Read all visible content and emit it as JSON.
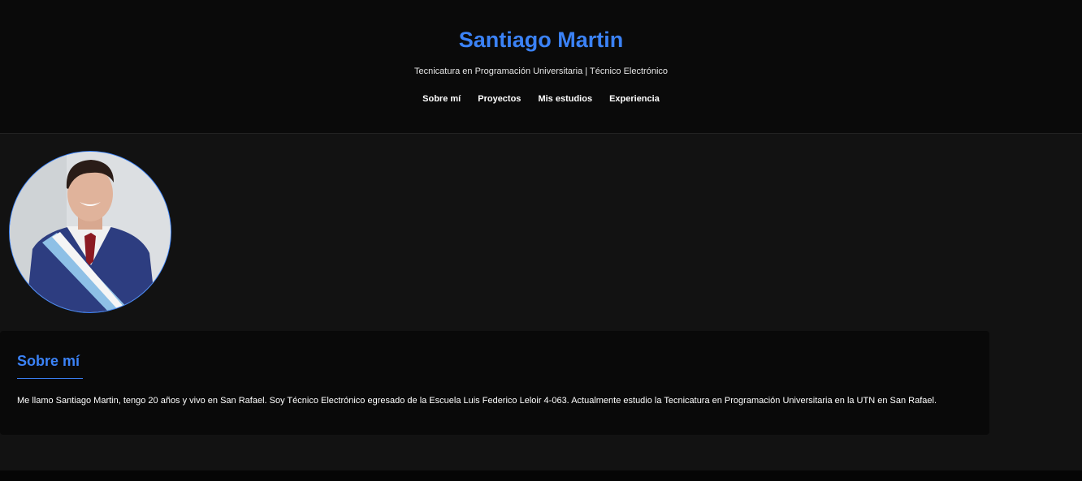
{
  "header": {
    "title": "Santiago Martin",
    "subtitle": "Tecnicatura en Programación Universitaria | Técnico Electrónico",
    "nav": [
      {
        "label": "Sobre mí"
      },
      {
        "label": "Proyectos"
      },
      {
        "label": "Mis estudios"
      },
      {
        "label": "Experiencia"
      }
    ]
  },
  "about": {
    "title": "Sobre mí",
    "text": "Me llamo Santiago Martin, tengo 20 años y vivo en San Rafael. Soy Técnico Electrónico egresado de la Escuela Luis Federico Leloir 4-063. Actualmente estudio la Tecnicatura en Programación Universitaria en la UTN en San Rafael."
  },
  "colors": {
    "accent": "#3b82f6",
    "header_bg": "#0a0a0a",
    "main_bg": "#121212",
    "card_bg": "#090909"
  }
}
